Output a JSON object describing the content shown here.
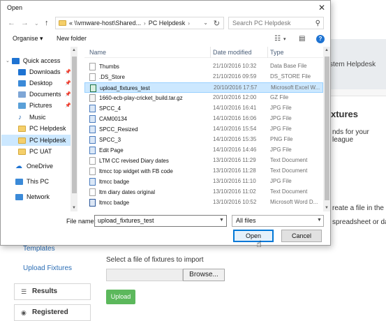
{
  "background": {
    "header_text": "stem Helpdesk",
    "heading": "xtures",
    "para_1": "nds for your league",
    "para_2": "reate a file in the c",
    "para_3": "spreadsheet or dat",
    "side_nav": {
      "templates": "Templates",
      "upload_fixtures": "Upload Fixtures",
      "results": "Results",
      "registered": "Registered"
    },
    "import_label": "Select a file of fixtures to import",
    "browse_label": "Browse...",
    "upload_label": "Upload"
  },
  "dialog": {
    "title": "Open",
    "address_segments": [
      "« \\\\vmware-host\\Shared...",
      "PC Helpdesk"
    ],
    "search_placeholder": "Search PC Helpdesk",
    "toolbar": {
      "organise": "Organise ▾",
      "new_folder": "New folder"
    },
    "nav_pane": [
      {
        "label": "Quick access",
        "icon": "star-icon",
        "color": "#1e73d2",
        "pinned": false,
        "selected": false
      },
      {
        "label": "Downloads",
        "icon": "download-icon",
        "color": "#1e73d2",
        "pinned": true,
        "selected": false
      },
      {
        "label": "Desktop",
        "icon": "desktop-icon",
        "color": "#3b8ad8",
        "pinned": true,
        "selected": false
      },
      {
        "label": "Documents",
        "icon": "documents-icon",
        "color": "#7ea6d6",
        "pinned": true,
        "selected": false
      },
      {
        "label": "Pictures",
        "icon": "pictures-icon",
        "color": "#5aa0d8",
        "pinned": true,
        "selected": false
      },
      {
        "label": "Music",
        "icon": "music-icon",
        "color": "#2b6cb0",
        "pinned": false,
        "selected": false
      },
      {
        "label": "PC Helpdesk",
        "icon": "folder-icon",
        "color": "#f5cf6a",
        "pinned": false,
        "selected": false
      },
      {
        "label": "PC Helpdesk",
        "icon": "folder-icon",
        "color": "#f5cf6a",
        "pinned": false,
        "selected": true
      },
      {
        "label": "PC UAT",
        "icon": "folder-icon",
        "color": "#f5cf6a",
        "pinned": false,
        "selected": false
      },
      {
        "label": "OneDrive",
        "icon": "cloud-icon",
        "color": "#1e73d2",
        "pinned": false,
        "selected": false
      },
      {
        "label": "This PC",
        "icon": "computer-icon",
        "color": "#3b8ad8",
        "pinned": false,
        "selected": false
      },
      {
        "label": "Network",
        "icon": "network-icon",
        "color": "#3b8ad8",
        "pinned": false,
        "selected": false
      }
    ],
    "columns": {
      "name": "Name",
      "date": "Date modified",
      "type": "Type"
    },
    "files": [
      {
        "name": "Thumbs",
        "date": "21/10/2016 10:32",
        "type": "Data Base File",
        "kind": "generic",
        "selected": false
      },
      {
        "name": ".DS_Store",
        "date": "21/10/2016 09:59",
        "type": "DS_STORE File",
        "kind": "generic",
        "selected": false
      },
      {
        "name": "upload_fixtures_test",
        "date": "20/10/2016 17:57",
        "type": "Microsoft Excel W...",
        "kind": "xls",
        "selected": true
      },
      {
        "name": "1660-ecb-play-cricket_build.tar.gz",
        "date": "20/10/2016 12:00",
        "type": "GZ File",
        "kind": "gz",
        "selected": false
      },
      {
        "name": "SPCC_4",
        "date": "14/10/2016 16:41",
        "type": "JPG File",
        "kind": "jpg",
        "selected": false
      },
      {
        "name": "CAM00134",
        "date": "14/10/2016 16:06",
        "type": "JPG File",
        "kind": "jpg",
        "selected": false
      },
      {
        "name": "SPCC_Resized",
        "date": "14/10/2016 15:54",
        "type": "JPG File",
        "kind": "jpg",
        "selected": false
      },
      {
        "name": "SPCC_3",
        "date": "14/10/2016 15:35",
        "type": "PNG File",
        "kind": "jpg",
        "selected": false
      },
      {
        "name": "Edit Page",
        "date": "14/10/2016 14:46",
        "type": "JPG File",
        "kind": "jpg",
        "selected": false
      },
      {
        "name": "LTM CC revised Diary dates",
        "date": "13/10/2016 11:29",
        "type": "Text Document",
        "kind": "generic",
        "selected": false
      },
      {
        "name": "ltmcc top widget with FB code",
        "date": "13/10/2016 11:28",
        "type": "Text Document",
        "kind": "generic",
        "selected": false
      },
      {
        "name": "ltmcc badge",
        "date": "13/10/2016 11:10",
        "type": "JPG File",
        "kind": "jpg",
        "selected": false
      },
      {
        "name": "ltm diary dates original",
        "date": "13/10/2016 11:02",
        "type": "Text Document",
        "kind": "generic",
        "selected": false
      },
      {
        "name": "ltmcc badge",
        "date": "13/10/2016 10:52",
        "type": "Microsoft Word D...",
        "kind": "doc",
        "selected": false
      }
    ],
    "file_name_label": "File name:",
    "file_name_value": "upload_fixtures_test",
    "file_type_filter": "All files",
    "open_label": "Open",
    "cancel_label": "Cancel"
  }
}
